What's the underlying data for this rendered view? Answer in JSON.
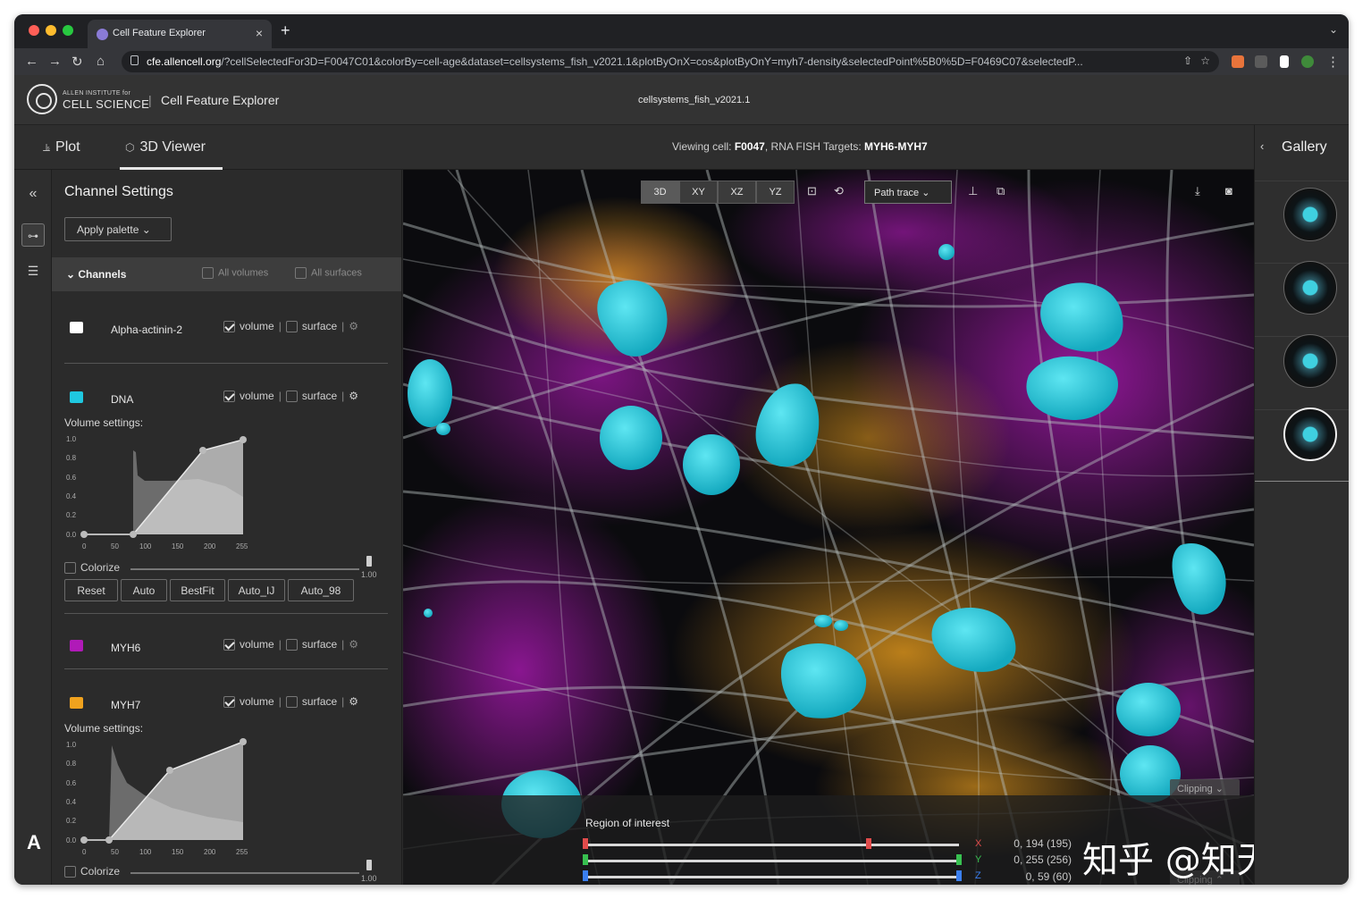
{
  "browser": {
    "tab_title": "Cell Feature Explorer",
    "new_tab": "+",
    "url_host": "cfe.allencell.org",
    "url_rest": "/?cellSelectedFor3D=F0047C01&colorBy=cell-age&dataset=cellsystems_fish_v2021.1&plotByOnX=cos&plotByOnY=myh7-density&selectedPoint%5B0%5D=F0469C07&selectedP...",
    "close": "×"
  },
  "app": {
    "org_small": "ALLEN INSTITUTE for",
    "org_name": "CELL SCIENCE",
    "separator": "|",
    "name": "Cell Feature Explorer",
    "dataset": "cellsystems_fish_v2021.1"
  },
  "tabs": {
    "plot": "Plot",
    "viewer": "3D Viewer",
    "viewing_prefix": "Viewing cell: ",
    "cell_id": "F0047",
    "targets_prefix": ", RNA FISH Targets: ",
    "targets": "MYH6-MYH7"
  },
  "panel": {
    "title": "Channel Settings",
    "apply_palette": "Apply palette",
    "channels_header": "Channels",
    "all_volumes": "All volumes",
    "all_surfaces": "All surfaces",
    "volume_label": "volume",
    "surface_label": "surface",
    "volume_settings": "Volume settings:",
    "colorize": "Colorize",
    "slider_value": "1.00",
    "buttons": [
      "Reset",
      "Auto",
      "BestFit",
      "Auto_IJ",
      "Auto_98"
    ],
    "y_ticks": [
      "1.0",
      "0.8",
      "0.6",
      "0.4",
      "0.2",
      "0.0"
    ],
    "x_ticks": [
      "0",
      "50",
      "100",
      "150",
      "200",
      "255"
    ],
    "channels": [
      {
        "name": "Alpha-actinin-2",
        "color": "#ffffff",
        "volume": true,
        "surface": false
      },
      {
        "name": "DNA",
        "color": "#1fc8e0",
        "volume": true,
        "surface": false
      },
      {
        "name": "MYH6",
        "color": "#b01ab8",
        "volume": true,
        "surface": false
      },
      {
        "name": "MYH7",
        "color": "#f0a21e",
        "volume": true,
        "surface": false
      }
    ]
  },
  "viewer": {
    "modes": [
      "3D",
      "XY",
      "XZ",
      "YZ"
    ],
    "render_mode": "Path trace",
    "clipping": "Clipping",
    "roi_label": "Region of interest",
    "axes": [
      "X",
      "Y",
      "Z"
    ],
    "coords": [
      "0, 194 (195)",
      "0, 255 (256)",
      "0, 59 (60)"
    ],
    "watermark": "知乎 @知无牙"
  },
  "gallery": {
    "title": "Gallery",
    "collapse": "‹"
  },
  "rail": {
    "label": "A"
  },
  "colors": {
    "nuclei": "#1fc8e0",
    "myh6": "#b01ab8",
    "myh7": "#f0a21e",
    "fibers": "#b8c2c2"
  }
}
